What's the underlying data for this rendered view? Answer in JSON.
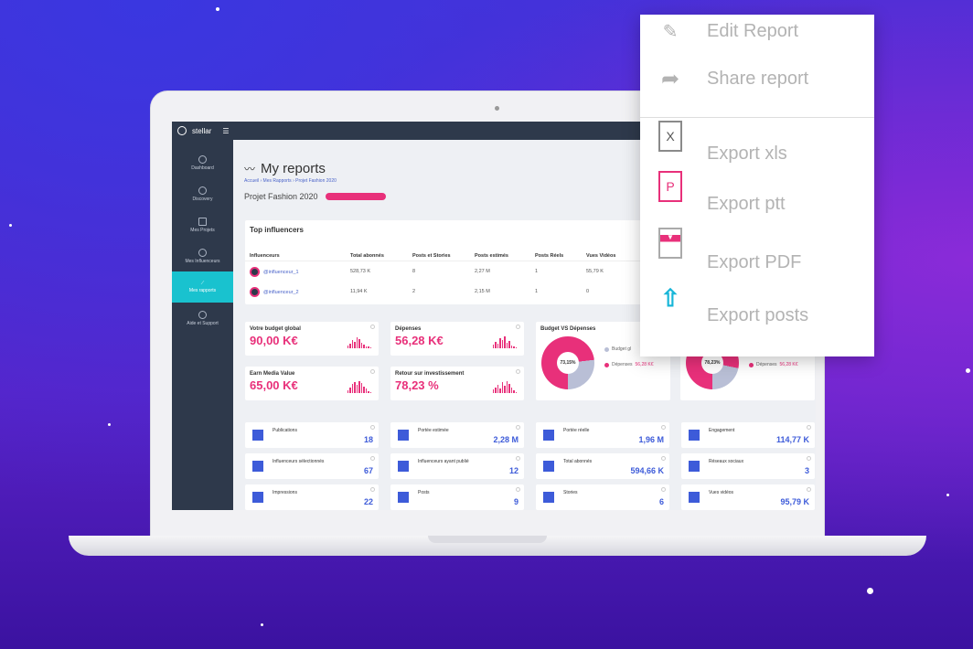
{
  "app": {
    "brand": "stellar"
  },
  "sidebar": {
    "items": [
      {
        "label": "Dashboard"
      },
      {
        "label": "Discovery"
      },
      {
        "label": "Mes Projets"
      },
      {
        "label": "Mes Influenceurs"
      },
      {
        "label": "Mes rapports",
        "active": true
      },
      {
        "label": "Aide et Support"
      }
    ]
  },
  "header": {
    "title": "My reports",
    "breadcrumb": "Accueil › Mes Rapports › Projet Fashion 2020",
    "project": "Projet Fashion 2020"
  },
  "table": {
    "title": "Top influencers",
    "columns": [
      "Influenceurs",
      "Total abonnés",
      "Posts et Stories",
      "Posts estimés",
      "Posts Réels",
      "Vues Vidéos"
    ],
    "rows": [
      [
        "@influenceur_1",
        "528,73 K",
        "8",
        "2,27 M",
        "1",
        "55,79 K"
      ],
      [
        "@influenceur_2",
        "11,94 K",
        "2",
        "2,15 M",
        "1",
        "0"
      ]
    ]
  },
  "kpis": [
    {
      "label": "Votre budget global",
      "value": "90,00 K€"
    },
    {
      "label": "Dépenses",
      "value": "56,28 K€"
    },
    {
      "label": "Earn Media Value",
      "value": "65,00 K€"
    },
    {
      "label": "Retour sur investissement",
      "value": "78,23 %"
    }
  ],
  "donuts": [
    {
      "title": "Budget VS Dépenses",
      "center": "73,15%",
      "percent": 73.15,
      "legend": [
        {
          "label": "Budget gl",
          "color": "#b9bfd6"
        },
        {
          "label": "Dépenses",
          "value": "56,28 K€",
          "color": "#e8307a"
        }
      ]
    },
    {
      "center": "78,23%",
      "percent": 78.23,
      "legend": [
        {
          "label": "Dépenses",
          "value": "56,28 K€",
          "color": "#e8307a"
        }
      ]
    }
  ],
  "stats": [
    {
      "label": "Publications",
      "value": "18"
    },
    {
      "label": "Portée estimée",
      "value": "2,28 M"
    },
    {
      "label": "Portée réelle",
      "value": "1,96 M"
    },
    {
      "label": "Engagement",
      "value": "114,77 K"
    },
    {
      "label": "Influenceurs sélectionnés",
      "value": "67"
    },
    {
      "label": "Influenceurs ayant publié",
      "value": "12"
    },
    {
      "label": "Total abonnés",
      "value": "594,66 K"
    },
    {
      "label": "Réseaux sociaux",
      "value": "3"
    },
    {
      "label": "Impressions",
      "value": "22"
    },
    {
      "label": "Posts",
      "value": "9"
    },
    {
      "label": "Stories",
      "value": "6"
    },
    {
      "label": "Vues vidéos",
      "value": "95,79 K"
    }
  ],
  "menu": {
    "items": [
      {
        "label": "Edit Report",
        "icon": "pencil-icon"
      },
      {
        "label": "Share report",
        "icon": "share-arrow-icon"
      },
      {
        "label": "Export xls",
        "icon": "xls-file-icon"
      },
      {
        "label": "Export ptt",
        "icon": "ppt-file-icon"
      },
      {
        "label": "Export PDF",
        "icon": "pdf-file-icon"
      },
      {
        "label": "Export posts",
        "icon": "upload-icon"
      }
    ]
  },
  "colors": {
    "accent": "#e8307a",
    "sidebar": "#2e394b",
    "active": "#19c2cf",
    "stat": "#3d5bd9"
  }
}
